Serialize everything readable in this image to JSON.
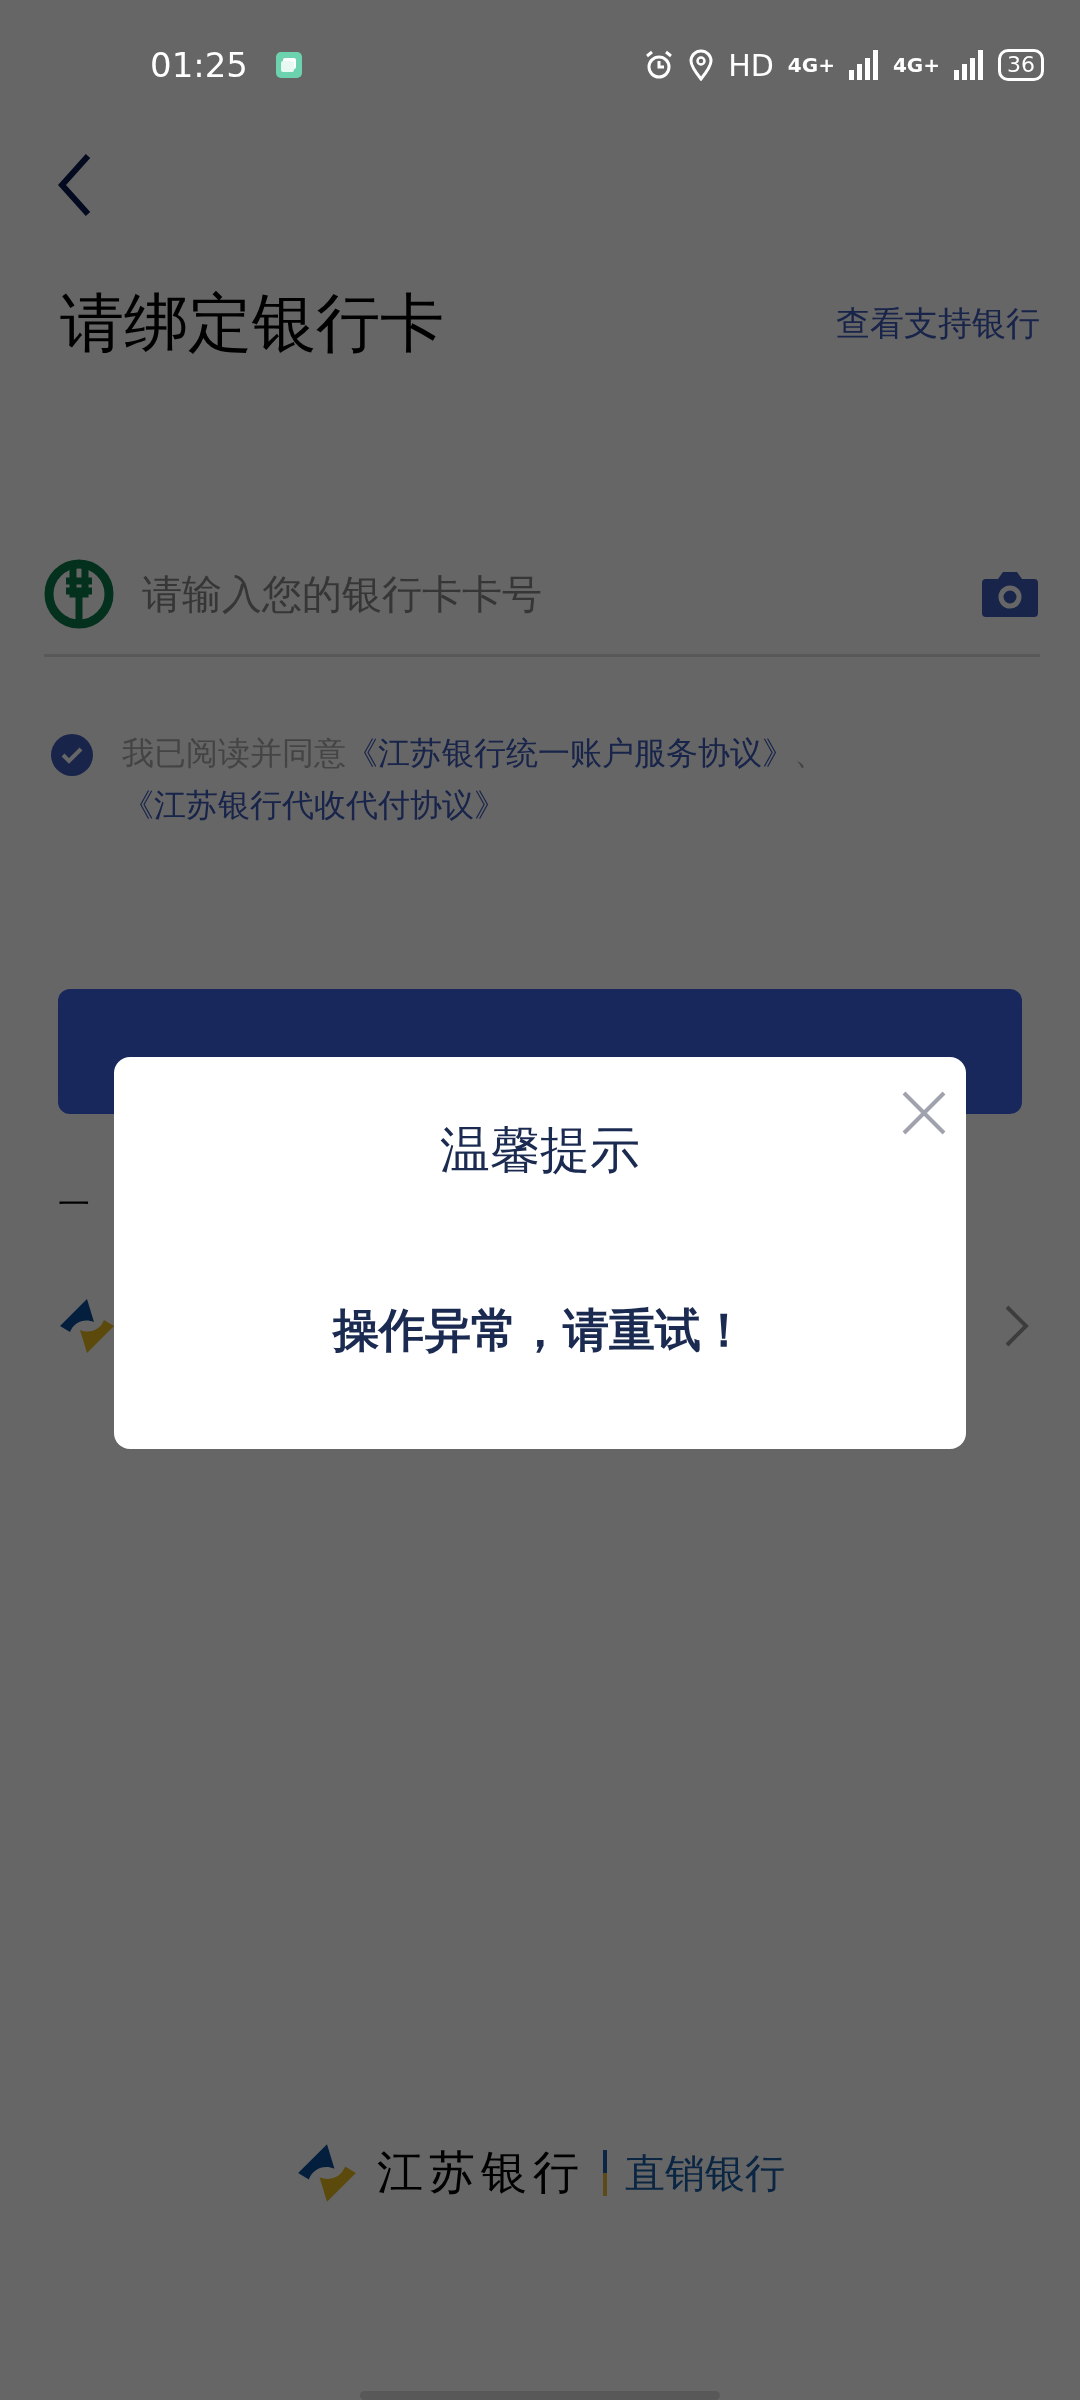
{
  "status_bar": {
    "time": "01:25",
    "hd": "HD",
    "networks": [
      "4G+",
      "4G+"
    ],
    "battery": "36"
  },
  "header": {
    "title": "请绑定银行卡",
    "link": "查看支持银行"
  },
  "card_field": {
    "placeholder": "请输入您的银行卡卡号"
  },
  "agreement": {
    "checked": true,
    "lead": "我已阅读并同意",
    "links": [
      "《江苏银行统一账户服务协议》",
      "《江苏银行代收代付协议》"
    ],
    "separator": "、"
  },
  "section_label": "一",
  "footer": {
    "bank_name": "江苏银行",
    "product": "直销银行"
  },
  "dialog": {
    "title": "温馨提示",
    "message": "操作异常，请重试！"
  }
}
